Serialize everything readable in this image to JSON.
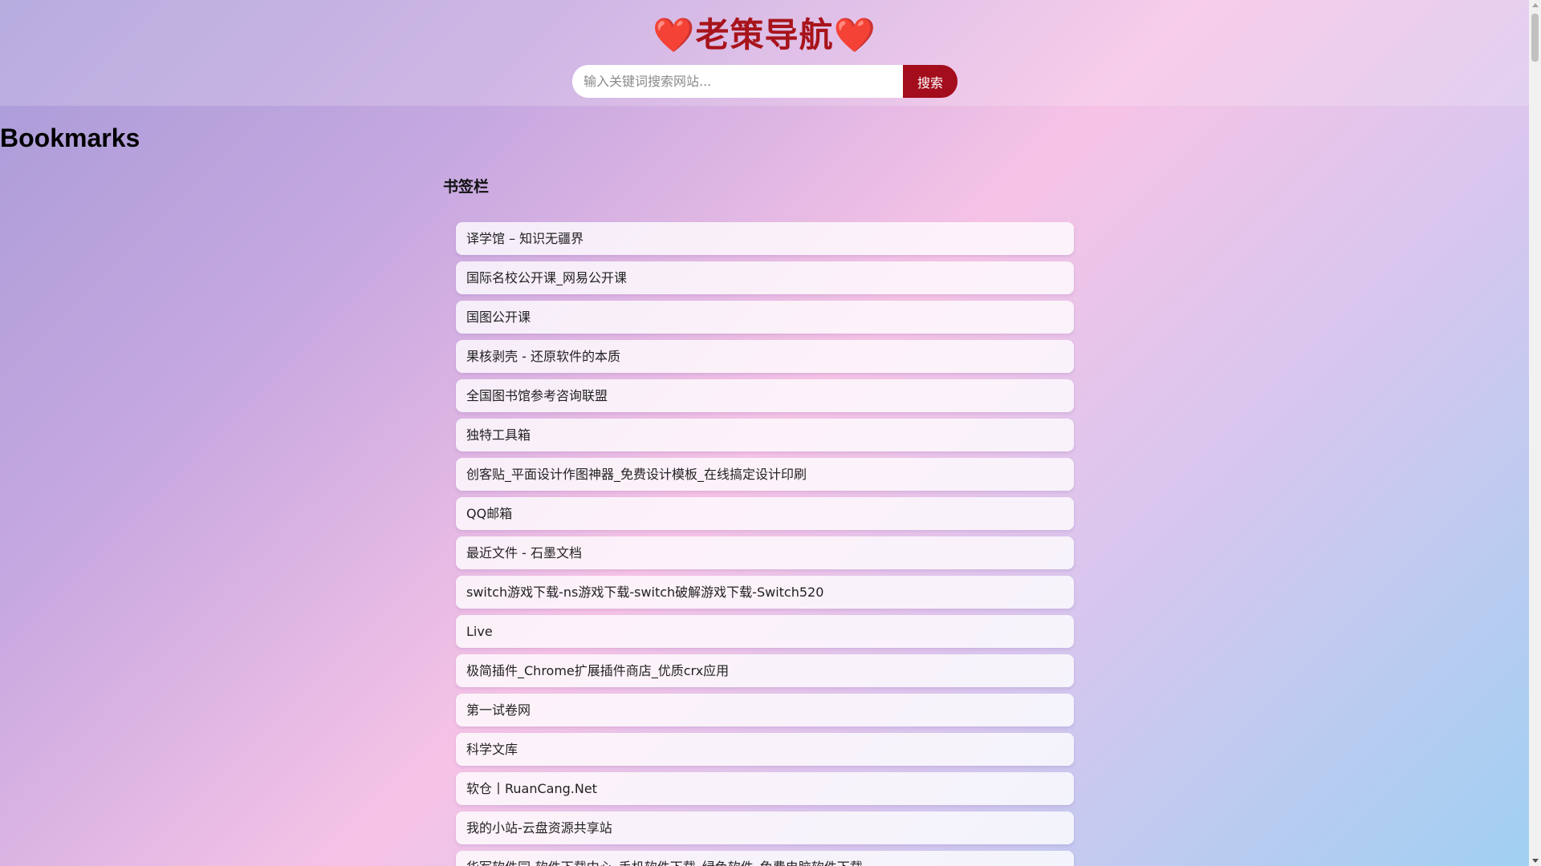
{
  "header": {
    "title_heart_left": "❤️",
    "title": "老策导航",
    "title_heart_right": "❤️"
  },
  "search": {
    "placeholder": "输入关键词搜索网站...",
    "value": "",
    "button_label": "搜索"
  },
  "page": {
    "heading": "Bookmarks"
  },
  "folder": {
    "title": "书签栏",
    "items": [
      {
        "label": "译学馆 – 知识无疆界"
      },
      {
        "label": "国际名校公开课_网易公开课"
      },
      {
        "label": "国图公开课"
      },
      {
        "label": "果核剥壳 - 还原软件的本质"
      },
      {
        "label": "全国图书馆参考咨询联盟"
      },
      {
        "label": "独特工具箱"
      },
      {
        "label": "创客贴_平面设计作图神器_免费设计模板_在线搞定设计印刷"
      },
      {
        "label": "QQ邮箱"
      },
      {
        "label": "最近文件 - 石墨文档"
      },
      {
        "label": "switch游戏下载-ns游戏下载-switch破解游戏下载-Switch520"
      },
      {
        "label": "Live"
      },
      {
        "label": "极简插件_Chrome扩展插件商店_优质crx应用"
      },
      {
        "label": "第一试卷网"
      },
      {
        "label": "科学文库"
      },
      {
        "label": "软仓丨RuanCang.Net"
      },
      {
        "label": "我的小站-云盘资源共享站"
      },
      {
        "label": "华军软件园-软件下载中心_手机软件下载_绿色软件_免费电脑软件下载"
      }
    ]
  },
  "colors": {
    "accent": "#a30d1c",
    "title": "#a8141b"
  }
}
